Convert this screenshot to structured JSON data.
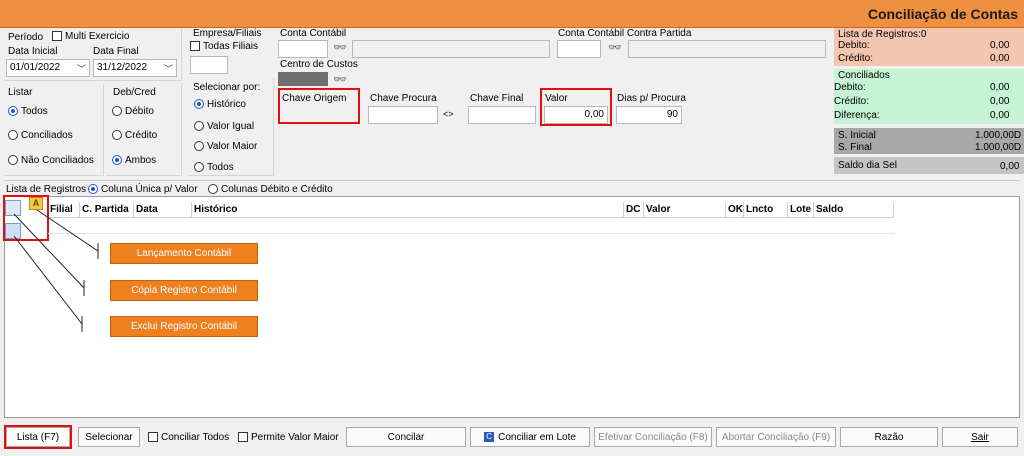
{
  "window": {
    "title": "Conciliação de Contas"
  },
  "periodo": {
    "label": "Período",
    "multi_exercicio": "Multi Exercicio",
    "data_inicial_label": "Data Inicial",
    "data_final_label": "Data Final",
    "data_inicial": "01/01/2022",
    "data_final": "31/12/2022"
  },
  "empresa": {
    "label": "Empresa/Filiais",
    "todas_filiais": "Todas Filiais"
  },
  "listar": {
    "label": "Listar",
    "options": [
      "Todos",
      "Conciliados",
      "Não Conciliados"
    ]
  },
  "debcred": {
    "label": "Deb/Cred",
    "options": [
      "Débito",
      "Crédito",
      "Ambos"
    ]
  },
  "selecionar_por": {
    "label": "Selecionar por:",
    "options": [
      "Histórico",
      "Valor Igual",
      "Valor Maior",
      "Todos"
    ]
  },
  "conta_contabil": {
    "label": "Conta Contábil"
  },
  "centro_custos": {
    "label": "Centro de Custos"
  },
  "conta_contabil_contra": {
    "label": "Conta Contábil Contra Partida"
  },
  "chave_origem": {
    "label": "Chave Origem"
  },
  "chave_procura": {
    "label": "Chave Procura"
  },
  "swap_symbol": "<>",
  "chave_final": {
    "label": "Chave Final"
  },
  "valor": {
    "label": "Valor",
    "value": "0,00"
  },
  "dias_procura": {
    "label": "Dias p/ Procura",
    "value": "90"
  },
  "summary": {
    "lista_registros": "Lista de Registros:0",
    "debito_label": "Debito:",
    "debito_value": "0,00",
    "credito_label": "Crédito:",
    "credito_value": "0,00",
    "conciliados_label": "Conciliados",
    "c_debito_label": "Debito:",
    "c_debito_value": "0,00",
    "c_credito_label": "Crédito:",
    "c_credito_value": "0,00",
    "diferenca_label": "Diferença:",
    "diferenca_value": "0,00",
    "s_inicial_label": "S. Inicial",
    "s_inicial_value": "1.000,00D",
    "s_final_label": "S. Final",
    "s_final_value": "1.000,00D",
    "saldo_dia_label": "Saldo dia Sel",
    "saldo_dia_value": "0,00"
  },
  "lista_mode": {
    "label": "Lista de Registros",
    "options": [
      "Coluna Única p/ Valor",
      "Colunas Débito e Crédito"
    ]
  },
  "grid": {
    "columns": [
      "Filial",
      "C. Partida",
      "Data",
      "Histórico",
      "DC",
      "Valor",
      "OK",
      "Lncto",
      "Lote",
      "Saldo"
    ]
  },
  "callouts": [
    "Lançamento Contábil",
    "Cópia Registro Contábil",
    "Exclui Registro Contábil"
  ],
  "footer": {
    "lista": "Lista (F7)",
    "selecionar": "Selecionar",
    "conciliar_todos": "Conciliar Todos",
    "permite_valor_maior": "Permite Valor Maior",
    "concilar": "Concilar",
    "conciliar_lote": "Conciliar  em Lote",
    "efetivar": "Efetivar Conciliação (F8)",
    "abortar": "Abortar Conciliação (F9)",
    "razao": "Razão",
    "sair": "Sair"
  },
  "colors": {
    "title_bar": "#ef8f3f",
    "highlight": "#e01010",
    "callout": "#ef8020",
    "pink_panel": "#f3c6b0",
    "green_panel": "#c6f2d6"
  }
}
